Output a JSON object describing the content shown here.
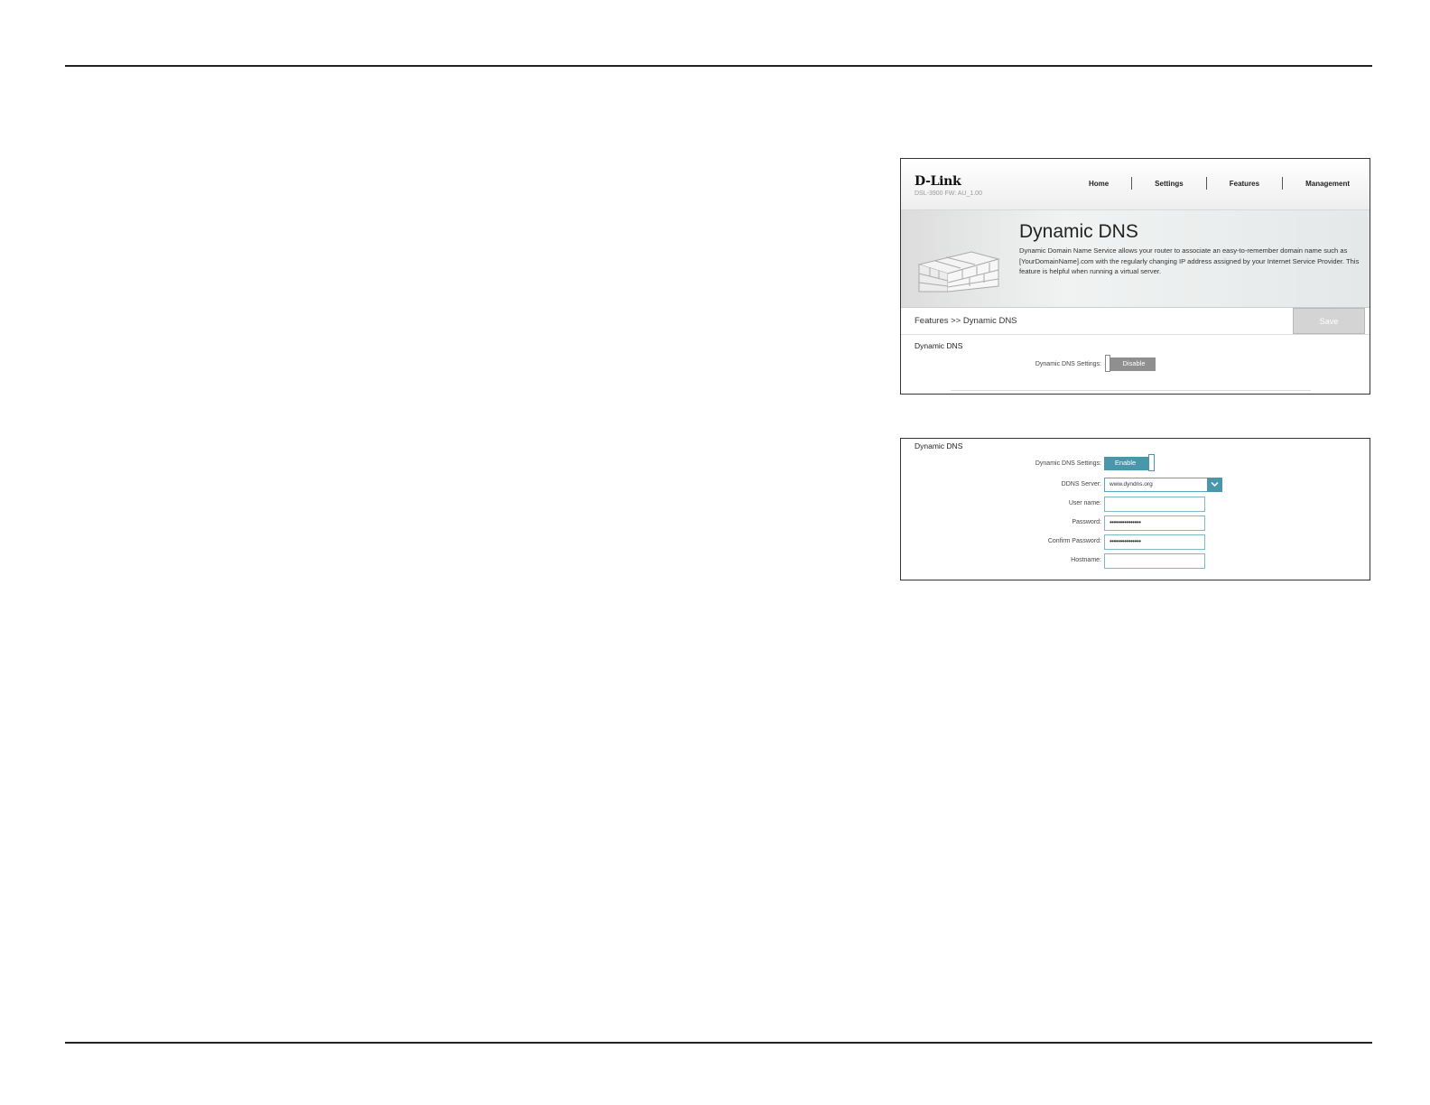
{
  "screenshot1": {
    "logo": "D-Link",
    "model": "DSL-3900   FW: AU_1.00",
    "nav": [
      "Home",
      "Settings",
      "Features",
      "Management"
    ],
    "banner": {
      "title": "Dynamic DNS",
      "description": "Dynamic Domain Name Service allows your router to associate an easy-to-remember domain name such as [YourDomainName].com with the regularly changing IP address assigned by your Internet Service Provider. This feature is helpful when running a virtual server."
    },
    "breadcrumb": "Features >> Dynamic DNS",
    "save_label": "Save",
    "section_title": "Dynamic DNS",
    "setting_label": "Dynamic DNS Settings:",
    "toggle_label": "Disable"
  },
  "screenshot2": {
    "section_title": "Dynamic DNS",
    "rows": {
      "settings_label": "Dynamic DNS Settings:",
      "toggle_label": "Enable",
      "server_label": "DDNS Server:",
      "server_value": "www.dyndns.org",
      "username_label": "User name:",
      "username_value": "",
      "password_label": "Password:",
      "password_value": "•••••••••••••••",
      "confirm_label": "Confirm Password:",
      "confirm_value": "•••••••••••••••",
      "hostname_label": "Hostname:",
      "hostname_value": ""
    }
  },
  "colors": {
    "accent": "#4a96ab",
    "toggle_off": "#8f8f8f",
    "save_disabled": "#d4d4d4"
  },
  "icons": [
    "brick-wall-icon",
    "chevron-down-icon"
  ]
}
